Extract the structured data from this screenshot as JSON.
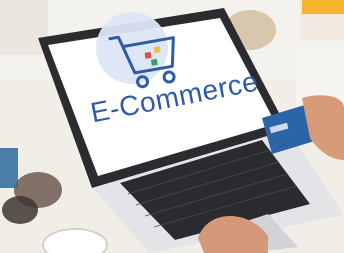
{
  "image": {
    "screen_text": "E-Commerce",
    "accent_color": "#f5b62c",
    "text_color": "#2f5aa8"
  }
}
